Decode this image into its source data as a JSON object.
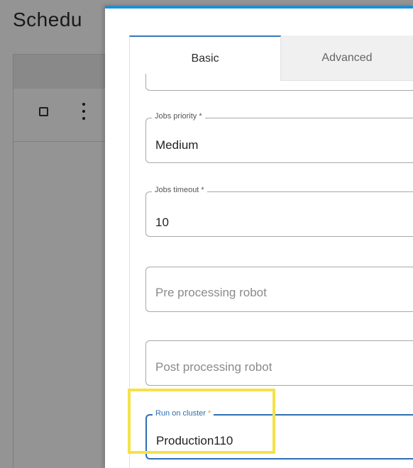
{
  "background": {
    "title": "Schedu"
  },
  "dialog": {
    "tabs": [
      {
        "label": "Basic",
        "active": true
      },
      {
        "label": "Advanced",
        "active": false
      }
    ],
    "fields": {
      "jobs_priority": {
        "label": "Jobs priority *",
        "value": "Medium"
      },
      "jobs_timeout": {
        "label": "Jobs timeout *",
        "value": "10"
      },
      "pre_processing_robot": {
        "placeholder": "Pre processing robot"
      },
      "post_processing_robot": {
        "placeholder": "Post processing robot"
      },
      "run_on_cluster": {
        "label": "Run on cluster",
        "required_mark": "*",
        "value": "Production110"
      }
    }
  },
  "colors": {
    "accent": "#1a8fd6",
    "focus_border": "#2d6fb3",
    "highlight": "#f4e24a",
    "required": "#e8a23c"
  }
}
